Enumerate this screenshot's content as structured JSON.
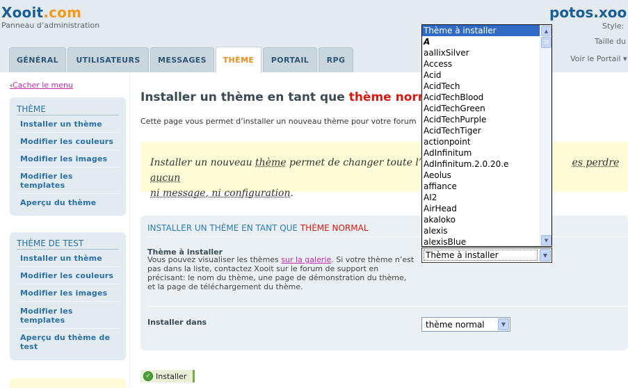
{
  "header": {
    "brand_main": "Xooit",
    "brand_tld": ".com",
    "subtitle": "Panneau d’administration",
    "right_title": "potos.xoo",
    "style_label": "Style:",
    "taille_label": "Taille du",
    "voir_label": "Voir le Portail ▾"
  },
  "tabs": [
    {
      "label": "GÉNÉRAL",
      "active": false
    },
    {
      "label": "UTILISATEURS",
      "active": false
    },
    {
      "label": "MESSAGES",
      "active": false
    },
    {
      "label": "THÈME",
      "active": true
    },
    {
      "label": "PORTAIL",
      "active": false
    },
    {
      "label": "RPG",
      "active": false
    }
  ],
  "sidebar": {
    "toggle_arrow": "‹",
    "toggle_label": "Cacher le menu",
    "box1": {
      "title": "THÈME",
      "items": [
        "Installer un thème",
        "Modifier les couleurs",
        "Modifier les images",
        "Modifier les templates",
        "Aperçu du thème"
      ]
    },
    "box2": {
      "title": "THÈME DE TEST",
      "items": [
        "Installer un thème",
        "Modifier les couleurs",
        "Modifier les images",
        "Modifier les templates",
        "Aperçu du thème de test"
      ]
    }
  },
  "main": {
    "title_prefix": "Installer un thème en tant que ",
    "title_red": "thème norm",
    "intro": "Cette page vous permet d’installer un nouveau thème pour votre forum",
    "notice_p1": "Installer un nouveau ",
    "notice_u1": "thème",
    "notice_p2": " permet de changer toute l’app",
    "notice_u2": "es perdre aucun",
    "notice_u3": "ni message, ni configuration",
    "notice_end": ".",
    "panel": {
      "title_prefix": "INSTALLER UN THÈME EN TANT QUE ",
      "title_red": "THÈME NORMAL",
      "field1_label": "Thème à installer",
      "field1_desc_pre": "Vous pouvez visualiser les thèmes ",
      "field1_desc_link": "sur la galerie",
      "field1_desc_post": ". Si votre thème n’est pas dans la liste, contactez Xooit sur le forum de support en précisant: le nom du thème, une page de démonstration du thème, et la page de téléchargement du thème.",
      "field1_select_value": "Thème à installer",
      "field2_label": "Installer dans",
      "field2_select_value": "thème normal"
    },
    "install_button": "Installer"
  },
  "dropdown": {
    "selected_index": 0,
    "options": [
      "Thème à installer",
      "A",
      "aallixSilver",
      "Access",
      "Acid",
      "AcidTech",
      "AcidTechBlood",
      "AcidTechGreen",
      "AcidTechPurple",
      "AcidTechTiger",
      "actionpoint",
      "AdInfinitum",
      "AdInfinitum.2.0.20.e",
      "Aeolus",
      "affiance",
      "AI2",
      "AirHead",
      "akaloko",
      "alexis",
      "alexisBlue"
    ]
  },
  "colors": {
    "brand_blue": "#1a5e96",
    "brand_orange": "#f39a1d",
    "accent_red": "#d61a10",
    "link_magenta": "#c028b0",
    "selection_blue": "#316ac5"
  }
}
